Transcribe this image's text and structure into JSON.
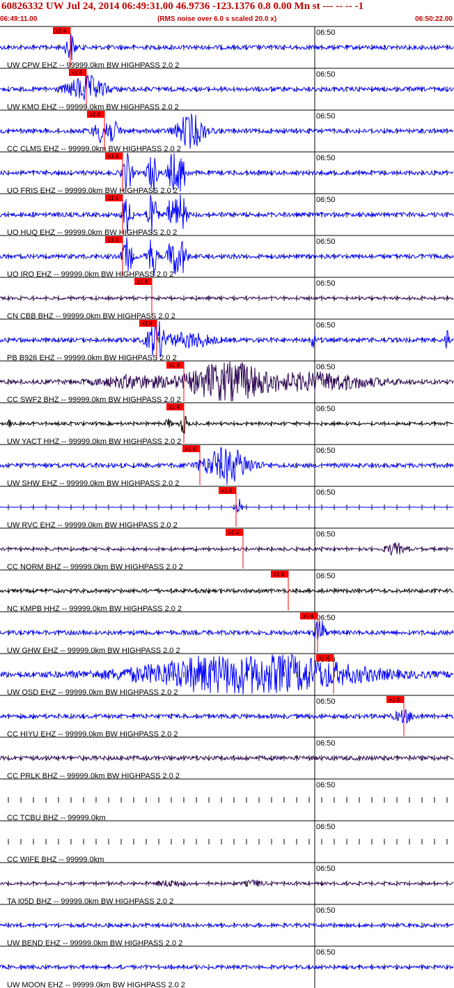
{
  "header": {
    "title": "60826332 UW Jul 24, 2014 06:49:31.00   46.9736 -123.1376  0.8 0.00 Mn st --- -- --  -1",
    "start_time": "06:49:11.00",
    "noise_note": "(RMS noise over 6.0 s scaled 20.0 x)",
    "end_time": "06:50:22.00"
  },
  "time_tick_label": "06:50",
  "pick_label": "x1 4",
  "colors": {
    "blue": "#0000ff",
    "dark": "#2a0050",
    "black": "#000000",
    "pick": "#ff0000",
    "header": "#c00000"
  },
  "traces": [
    {
      "label": "UW CPW EHZ -- 99999.0km BW  HIGHPASS  2.0  2",
      "color": "#0000ff",
      "amp": 3,
      "pick": 0.155,
      "bursts": [
        [
          0.155,
          0.01,
          20
        ]
      ]
    },
    {
      "label": "UW KMO EHZ -- 99999.0km BW  HIGHPASS  2.0  2",
      "color": "#0000ff",
      "amp": 3,
      "pick": 0.19,
      "bursts": [
        [
          0.19,
          0.04,
          18
        ]
      ]
    },
    {
      "label": "CC CLMS EHZ -- 99999.0km BW  HIGHPASS  2.0  2",
      "color": "#0000ff",
      "amp": 3,
      "pick": 0.23,
      "bursts": [
        [
          0.235,
          0.025,
          20
        ],
        [
          0.42,
          0.03,
          24
        ]
      ]
    },
    {
      "label": "UO FRIS EHZ -- 99999.0km BW  HIGHPASS  2.0  2",
      "color": "#0000ff",
      "amp": 3,
      "pick": 0.27,
      "bursts": [
        [
          0.28,
          0.01,
          30
        ],
        [
          0.335,
          0.01,
          30
        ],
        [
          0.38,
          0.01,
          30
        ],
        [
          0.4,
          0.01,
          28
        ]
      ]
    },
    {
      "label": "UO HUQ EHZ -- 99999.0km BW  HIGHPASS  2.0  2",
      "color": "#0000ff",
      "amp": 3,
      "pick": 0.27,
      "bursts": [
        [
          0.28,
          0.01,
          30
        ],
        [
          0.335,
          0.01,
          30
        ],
        [
          0.38,
          0.01,
          30
        ],
        [
          0.4,
          0.01,
          28
        ]
      ]
    },
    {
      "label": "UO IRO EHZ -- 99999.0km BW  HIGHPASS  2.0  2",
      "color": "#0000ff",
      "amp": 3,
      "pick": 0.27,
      "bursts": [
        [
          0.28,
          0.01,
          30
        ],
        [
          0.335,
          0.01,
          30
        ],
        [
          0.38,
          0.01,
          30
        ],
        [
          0.4,
          0.01,
          28
        ]
      ]
    },
    {
      "label": "CN CBB BHZ -- 99999.0km BW  HIGHPASS  2.0  2",
      "color": "#2a0050",
      "amp": 2,
      "pick": 0.335,
      "bursts": []
    },
    {
      "label": "PB B926 EHZ -- 99999.0km BW  HIGHPASS  2.0  2",
      "color": "#0000ff",
      "amp": 3,
      "pick": 0.345,
      "bursts": [
        [
          0.345,
          0.02,
          25
        ],
        [
          0.42,
          0.05,
          10
        ],
        [
          0.69,
          0.004,
          16
        ],
        [
          0.985,
          0.004,
          18
        ]
      ]
    },
    {
      "label": "CC SWF2 BHZ -- 99999.0km BW  HIGHPASS  2.0  2",
      "color": "#2a0050",
      "amp": 3,
      "pick": 0.405,
      "bursts": [
        [
          0.5,
          0.08,
          30
        ],
        [
          0.3,
          0.08,
          8
        ],
        [
          0.7,
          0.12,
          12
        ]
      ]
    },
    {
      "label": "UW YACT HHZ -- 99999.0km BW  HIGHPASS  2.0  2",
      "color": "#000000",
      "amp": 2,
      "pick": 0.405,
      "bursts": [
        [
          0.405,
          0.008,
          14
        ],
        [
          0.37,
          0.005,
          8
        ],
        [
          0.02,
          0.004,
          6
        ]
      ]
    },
    {
      "label": "UW SHW EHZ -- 99999.0km BW  HIGHPASS  2.0  2",
      "color": "#0000ff",
      "amp": 3,
      "pick": 0.44,
      "bursts": [
        [
          0.5,
          0.05,
          25
        ]
      ]
    },
    {
      "label": "UW RVC EHZ -- 99999.0km BW  HIGHPASS  2.0  2",
      "color": "#0000ff",
      "amp": 0.4,
      "pick": 0.52,
      "bursts": [
        [
          0.525,
          0.008,
          14
        ]
      ]
    },
    {
      "label": "CC NORM BHZ -- 99999.0km BW  HIGHPASS  2.0  2",
      "color": "#2a0050",
      "amp": 2,
      "pick": 0.535,
      "bursts": [
        [
          0.87,
          0.02,
          8
        ]
      ]
    },
    {
      "label": "NC KMPB HHZ -- 99999.0km BW  HIGHPASS  2.0  2",
      "color": "#000000",
      "amp": 2.5,
      "pick": 0.635,
      "bursts": []
    },
    {
      "label": "UW GHW EHZ -- 99999.0km BW  HIGHPASS  2.0  2",
      "color": "#0000ff",
      "amp": 3,
      "pick": 0.7,
      "bursts": [
        [
          0.705,
          0.01,
          22
        ]
      ]
    },
    {
      "label": "UW OSD EHZ -- 99999.0km BW  HIGHPASS  2.0  2",
      "color": "#0000ff",
      "amp": 4,
      "pick": 0.735,
      "bursts": [
        [
          0.55,
          0.22,
          30
        ]
      ]
    },
    {
      "label": "CC HIYU EHZ -- 99999.0km BW  HIGHPASS  2.0  2",
      "color": "#0000ff",
      "amp": 3,
      "pick": 0.89,
      "bursts": [
        [
          0.89,
          0.02,
          8
        ]
      ]
    },
    {
      "label": "CC PRLK BHZ -- 99999.0km BW  HIGHPASS  2.0  2",
      "color": "#2a0050",
      "amp": 3,
      "pick": null,
      "bursts": []
    },
    {
      "label": "CC TCBU BHZ -- 99999.0km",
      "color": null,
      "amp": 0,
      "pick": null,
      "bursts": []
    },
    {
      "label": "CC WIFE BHZ -- 99999.0km",
      "color": null,
      "amp": 0,
      "pick": null,
      "bursts": []
    },
    {
      "label": "TA I05D BHZ -- 99999.0km BW  HIGHPASS  2.0  2",
      "color": "#2a0050",
      "amp": 2,
      "pick": null,
      "bursts": [
        [
          0.38,
          0.03,
          4
        ],
        [
          0.56,
          0.02,
          4
        ]
      ]
    },
    {
      "label": "UW BEND EHZ -- 99999.0km BW  HIGHPASS  2.0  2",
      "color": "#0000ff",
      "amp": 2.5,
      "pick": null,
      "bursts": []
    },
    {
      "label": "UW MOON EHZ -- 99999.0km BW  HIGHPASS  2.0  2",
      "color": "#0000ff",
      "amp": 2.5,
      "pick": null,
      "bursts": []
    }
  ]
}
